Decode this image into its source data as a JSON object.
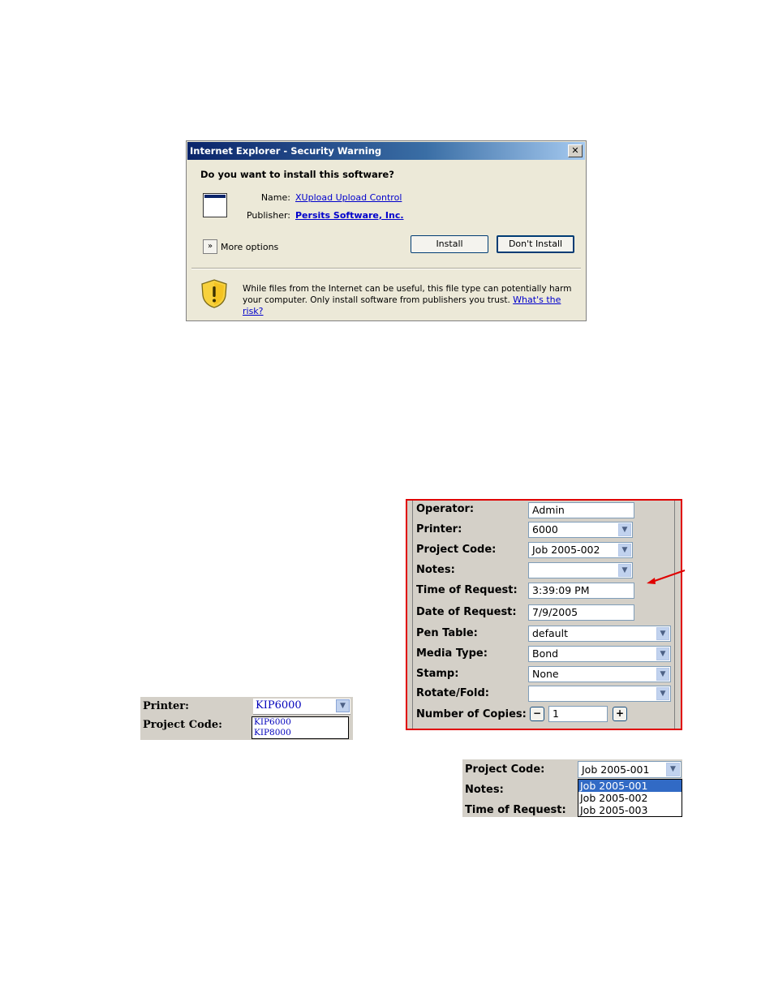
{
  "dialog": {
    "title": "Internet Explorer - Security Warning",
    "close_glyph": "✕",
    "question": "Do you want to install this software?",
    "name_label": "Name:",
    "name_value": "XUpload Upload Control",
    "publisher_label": "Publisher:",
    "publisher_value": "Persits Software, Inc.",
    "more_options": "More options",
    "install_button": "Install",
    "dont_install_button": "Don't Install",
    "warning_text": "While files from the Internet can be useful, this file type can potentially harm your computer. Only install software from publishers you trust.",
    "risk_link": "What's the risk?"
  },
  "form": {
    "operator": {
      "label": "Operator:",
      "value": "Admin"
    },
    "printer": {
      "label": "Printer:",
      "value": "6000"
    },
    "project_code": {
      "label": "Project Code:",
      "value": "Job 2005-002"
    },
    "notes": {
      "label": "Notes:",
      "value": ""
    },
    "time_of_request": {
      "label": "Time of Request:",
      "value": "3:39:09 PM"
    },
    "date_of_request": {
      "label": "Date of Request:",
      "value": "7/9/2005"
    },
    "pen_table": {
      "label": "Pen Table:",
      "value": "default"
    },
    "media_type": {
      "label": "Media Type:",
      "value": "Bond"
    },
    "stamp": {
      "label": "Stamp:",
      "value": "None"
    },
    "rotate_fold": {
      "label": "Rotate/Fold:",
      "value": ""
    },
    "number_of_copies": {
      "label": "Number of Copies:",
      "value": "1",
      "minus": "−",
      "plus": "+"
    },
    "accent_color": "#e00000"
  },
  "printer_snippet": {
    "printer_label": "Printer:",
    "project_code_label": "Project Code:",
    "selected": "KIP6000",
    "options": [
      "KIP6000",
      "KIP8000"
    ]
  },
  "project_snippet": {
    "project_code_label": "Project Code:",
    "notes_label": "Notes:",
    "time_label": "Time of Request:",
    "selected": "Job 2005-001",
    "options": [
      "Job 2005-001",
      "Job 2005-002",
      "Job 2005-003"
    ],
    "highlight_color": "#316ac5"
  }
}
